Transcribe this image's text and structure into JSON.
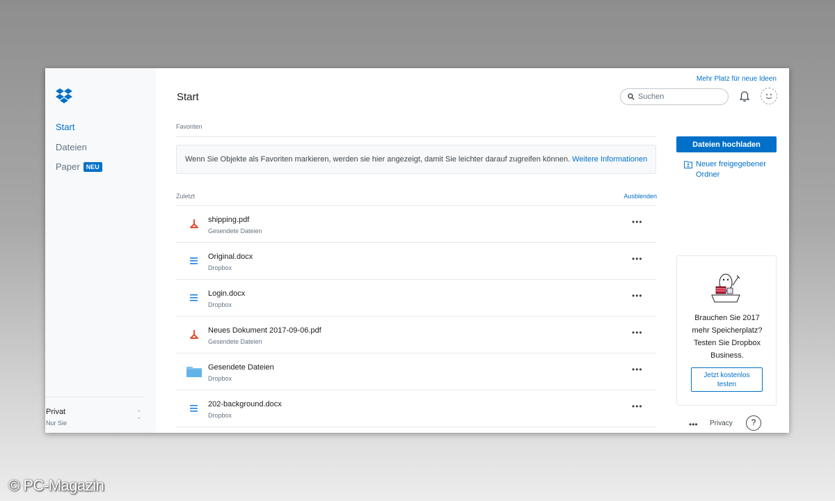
{
  "sidebar": {
    "nav": [
      {
        "label": "Start",
        "active": true
      },
      {
        "label": "Dateien",
        "active": false
      },
      {
        "label": "Paper",
        "active": false,
        "badge": "NEU"
      }
    ],
    "account": {
      "name": "Privat",
      "subtitle": "Nur Sie"
    }
  },
  "header": {
    "title": "Start",
    "promo_link": "Mehr Platz für neue Ideen",
    "search_placeholder": "Suchen"
  },
  "favorites": {
    "label": "Favoriten",
    "info_text": "Wenn Sie Objekte als Favoriten markieren, werden sie hier angezeigt, damit Sie leichter darauf zugreifen können.",
    "info_link": "Weitere Informationen"
  },
  "recent": {
    "label": "Zuletzt",
    "hide_link": "Ausblenden",
    "files": [
      {
        "name": "shipping.pdf",
        "location": "Gesendete Dateien",
        "type": "pdf-icon"
      },
      {
        "name": "Original.docx",
        "location": "Dropbox",
        "type": "doc-icon"
      },
      {
        "name": "Login.docx",
        "location": "Dropbox",
        "type": "doc-icon"
      },
      {
        "name": "Neues Dokument 2017-09-06.pdf",
        "location": "Gesendete Dateien",
        "type": "pdf-icon"
      },
      {
        "name": "Gesendete Dateien",
        "location": "Dropbox",
        "type": "folder-icon"
      },
      {
        "name": "202-background.docx",
        "location": "Dropbox",
        "type": "doc-icon"
      }
    ],
    "more_label": "•••"
  },
  "actions": {
    "upload_label": "Dateien hochladen",
    "new_shared_folder": "Neuer freigegebener Ordner"
  },
  "upsell": {
    "text_lines": [
      "Brauchen Sie 2017",
      "mehr Speicherplatz?",
      "Testen Sie Dropbox",
      "Business."
    ],
    "button_line1": "Jetzt kostenlos",
    "button_line2": "testen"
  },
  "footer": {
    "more": "•••",
    "privacy": "Privacy",
    "help": "?"
  },
  "watermark": "© PC-Magazin",
  "colors": {
    "accent": "#0070c9",
    "pdf": "#e64a2e",
    "doc": "#1a82e2",
    "folder": "#7fc3ee"
  }
}
